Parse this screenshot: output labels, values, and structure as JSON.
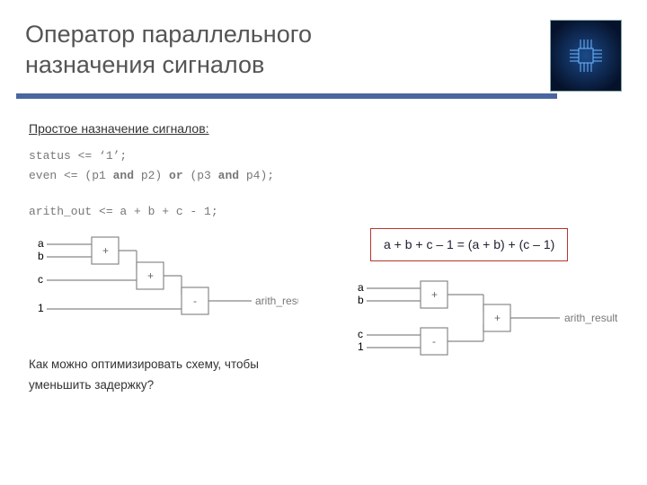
{
  "header": {
    "title_line1": "Оператор параллельного",
    "title_line2": "назначения сигналов"
  },
  "section": {
    "subhead": "Простое назначение сигналов:",
    "code": {
      "line1_pre": "status <= ‘1’;",
      "line2_pre": "even <= (p1 ",
      "line2_kw1": "and",
      "line2_mid1": " p2) ",
      "line2_kw2": "or",
      "line2_mid2": " (p3 ",
      "line2_kw3": "and",
      "line2_end": " p4);",
      "line3": "arith_out <= a + b + c - 1;"
    },
    "formula": "a + b + c – 1 = (a + b) + (c – 1)",
    "question": "Как можно оптимизировать схему, чтобы уменьшить задержку?"
  },
  "diagram_left": {
    "labels": {
      "a": "a",
      "b": "b",
      "c": "c",
      "one": "1",
      "out": "arith_result"
    },
    "ops": {
      "add1": "+",
      "add2": "+",
      "sub": "-"
    }
  },
  "diagram_right": {
    "labels": {
      "a": "a",
      "b": "b",
      "c": "c",
      "one": "1",
      "out": "arith_result"
    },
    "ops": {
      "add1": "+",
      "sub": "-",
      "add2": "+"
    }
  }
}
